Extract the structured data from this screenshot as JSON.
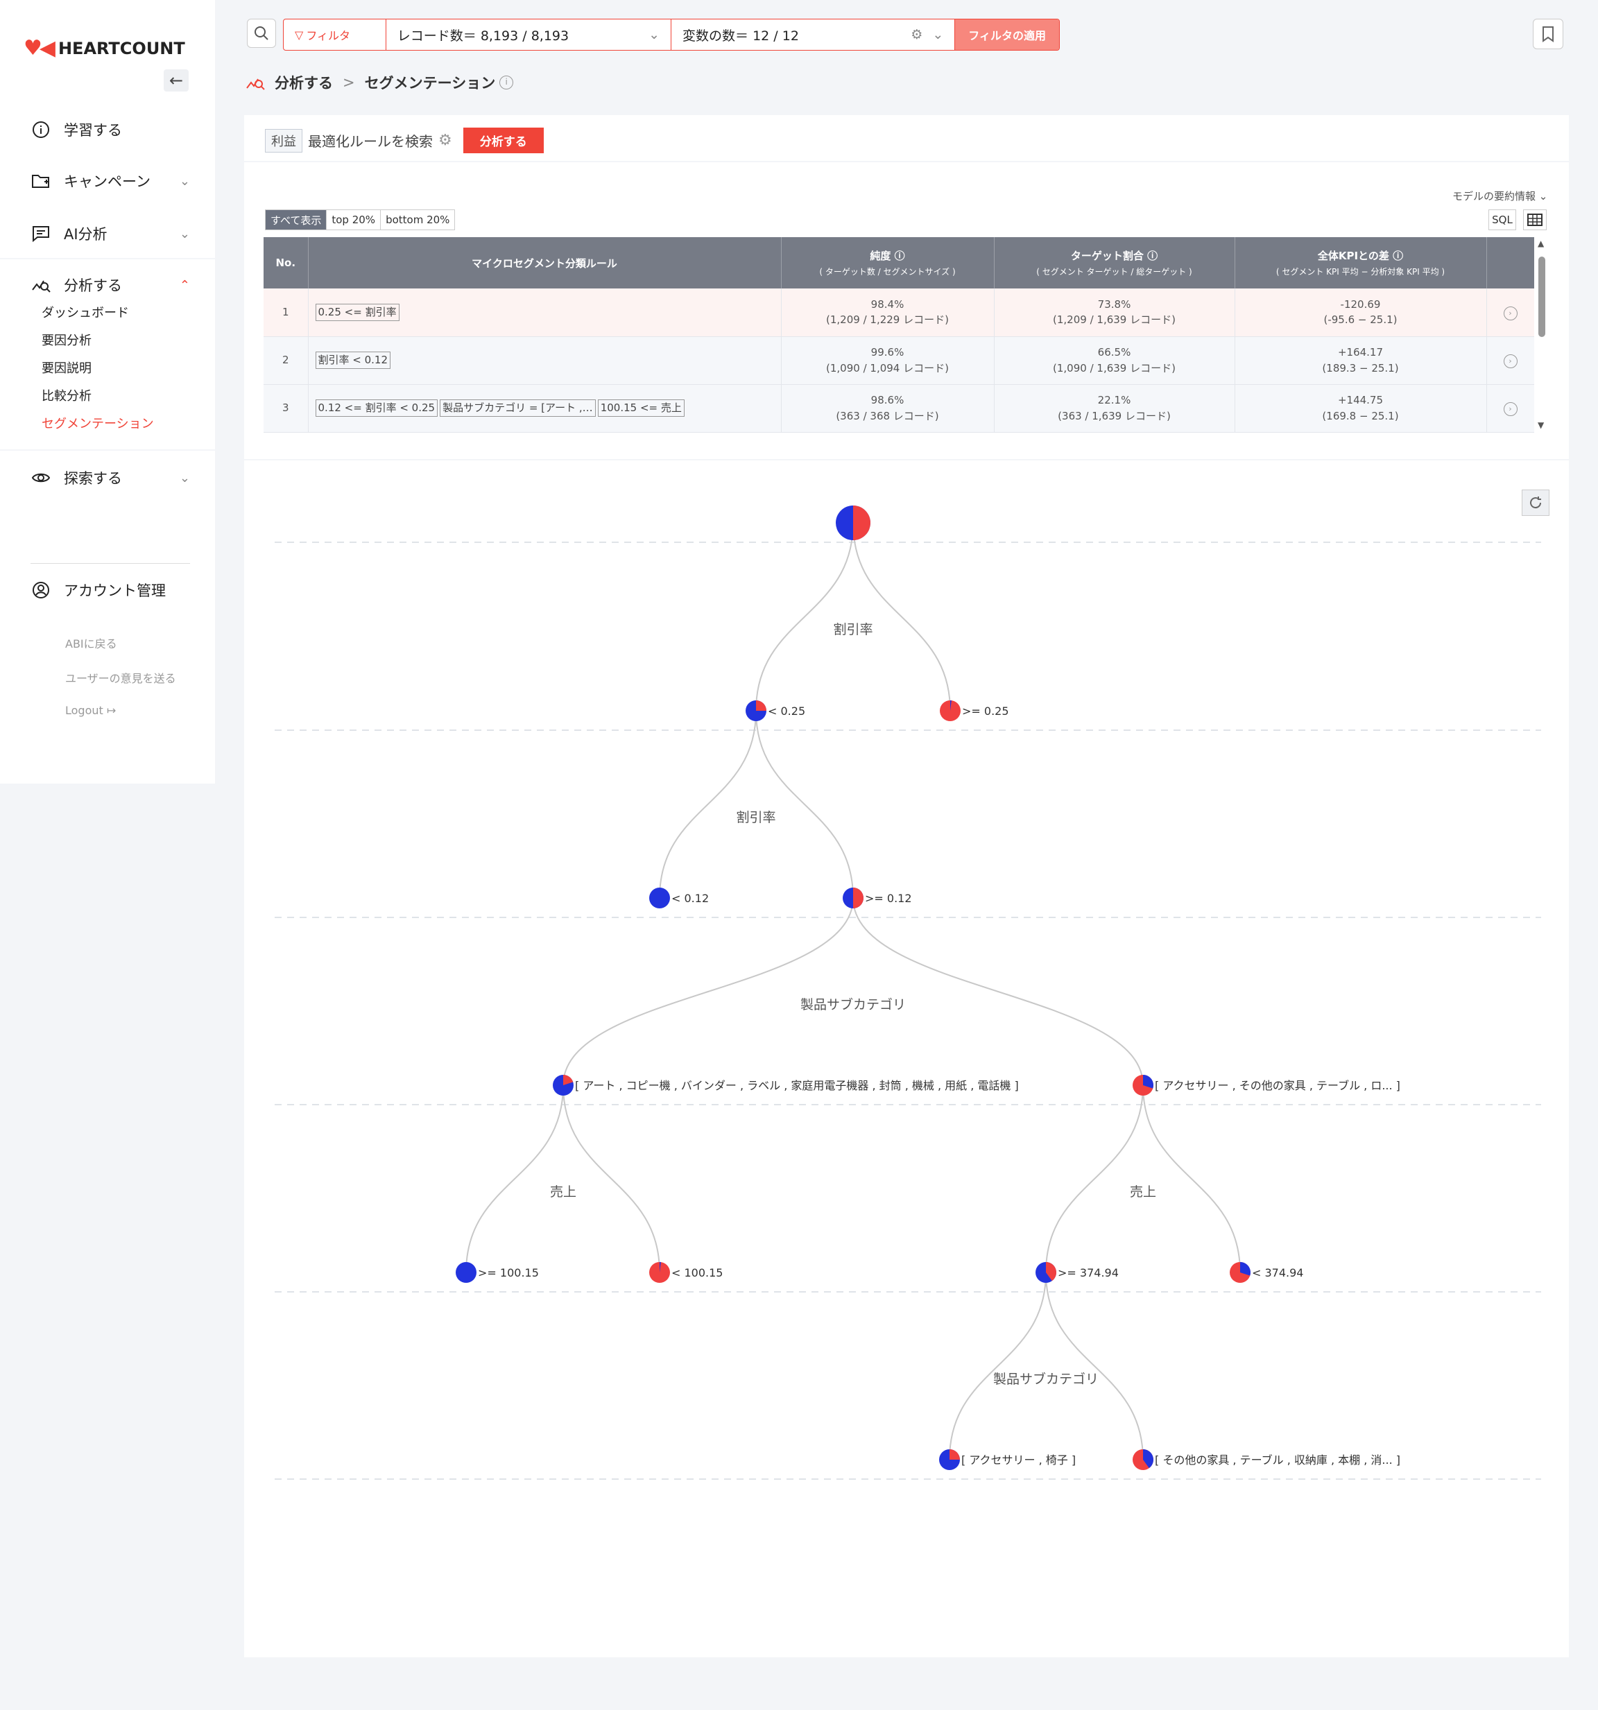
{
  "app": {
    "brand": "HEARTCOUNT"
  },
  "sidebar": {
    "items": [
      {
        "label": "学習する"
      },
      {
        "label": "キャンペーン"
      },
      {
        "label": "AI分析"
      },
      {
        "label": "分析する"
      },
      {
        "label": "探索する"
      }
    ],
    "sub_items": [
      "ダッシュボード",
      "要因分析",
      "要因説明",
      "比較分析",
      "セグメンテーション"
    ],
    "account": "アカウント管理",
    "links": [
      "ABIに戻る",
      "ユーザーの意見を送る",
      "Logout"
    ]
  },
  "topbar": {
    "filter_label": "フィルタ",
    "records": "レコード数＝ 8,193 / 8,193",
    "variables": "変数の数＝ 12 / 12",
    "apply": "フィルタの適用"
  },
  "breadcrumb": {
    "parent": "分析する",
    "separator": ">",
    "current": "セグメンテーション"
  },
  "analysis": {
    "target_tag": "利益",
    "search_label": "最適化ルールを検索",
    "run_button": "分析する"
  },
  "model_summary": "モデルの要約情報",
  "toggles": [
    "すべて表示",
    "top 20%",
    "bottom 20%"
  ],
  "sql_button": "SQL",
  "table": {
    "headers": {
      "no": "No.",
      "rule": "マイクロセグメント分類ルール",
      "purity": "純度",
      "purity_sub": "( ターゲット数 / セグメントサイズ )",
      "target": "ターゲット割合",
      "target_sub": "( セグメント ターゲット / 総ターゲット )",
      "kpi": "全体KPIとの差",
      "kpi_sub": "( セグメント KPI 平均 − 分析対象 KPI 平均 )"
    },
    "rows": [
      {
        "no": "1",
        "rules": [
          "0.25 <= 割引率"
        ],
        "purity": "98.4%",
        "purity_detail": "(1,209 / 1,229 レコード)",
        "target": "73.8%",
        "target_detail": "(1,209 / 1,639 レコード)",
        "kpi": "-120.69",
        "kpi_detail": "(-95.6 − 25.1)"
      },
      {
        "no": "2",
        "rules": [
          "割引率 < 0.12"
        ],
        "purity": "99.6%",
        "purity_detail": "(1,090 / 1,094 レコード)",
        "target": "66.5%",
        "target_detail": "(1,090 / 1,639 レコード)",
        "kpi": "+164.17",
        "kpi_detail": "(189.3 − 25.1)"
      },
      {
        "no": "3",
        "rules": [
          "0.12 <= 割引率 < 0.25",
          "製品サブカテゴリ = [アート ,…",
          "100.15 <= 売上"
        ],
        "purity": "98.6%",
        "purity_detail": "(363 / 368 レコード)",
        "target": "22.1%",
        "target_detail": "(363 / 1,639 レコード)",
        "kpi": "+144.75",
        "kpi_detail": "(169.8 − 25.1)"
      }
    ]
  },
  "tree": {
    "colors": {
      "blue": "#2233dd",
      "red": "#f04040"
    },
    "split_labels": [
      "割引率",
      "割引率",
      "製品サブカテゴリ",
      "売上",
      "売上",
      "製品サブカテゴリ"
    ],
    "nodes": [
      {
        "id": "root",
        "label": "",
        "red_share": 0.5
      },
      {
        "id": "n1",
        "label": "< 0.25",
        "red_share": 0.25
      },
      {
        "id": "n2",
        "label": ">= 0.25",
        "red_share": 0.98
      },
      {
        "id": "n3",
        "label": "< 0.12",
        "red_share": 0.0
      },
      {
        "id": "n4",
        "label": ">= 0.12",
        "red_share": 0.5
      },
      {
        "id": "n5",
        "label": "[ アート , コピー機 , バインダー , ラベル , 家庭用電子機器 , 封筒 , 機械 , 用紙 , 電話機 ]",
        "red_share": 0.2
      },
      {
        "id": "n6",
        "label": "[ アクセサリー , その他の家具 , テーブル , ロ... ]",
        "red_share": 0.7
      },
      {
        "id": "n7",
        "label": ">= 100.15",
        "red_share": 0.0
      },
      {
        "id": "n8",
        "label": "< 100.15",
        "red_share": 0.98
      },
      {
        "id": "n9",
        "label": ">= 374.94",
        "red_share": 0.4
      },
      {
        "id": "n10",
        "label": "< 374.94",
        "red_share": 0.7
      },
      {
        "id": "n11",
        "label": "[ アクセサリー , 椅子 ]",
        "red_share": 0.25
      },
      {
        "id": "n12",
        "label": "[ その他の家具 , テーブル , 収納庫 , 本棚 , 消... ]",
        "red_share": 0.6
      }
    ]
  }
}
